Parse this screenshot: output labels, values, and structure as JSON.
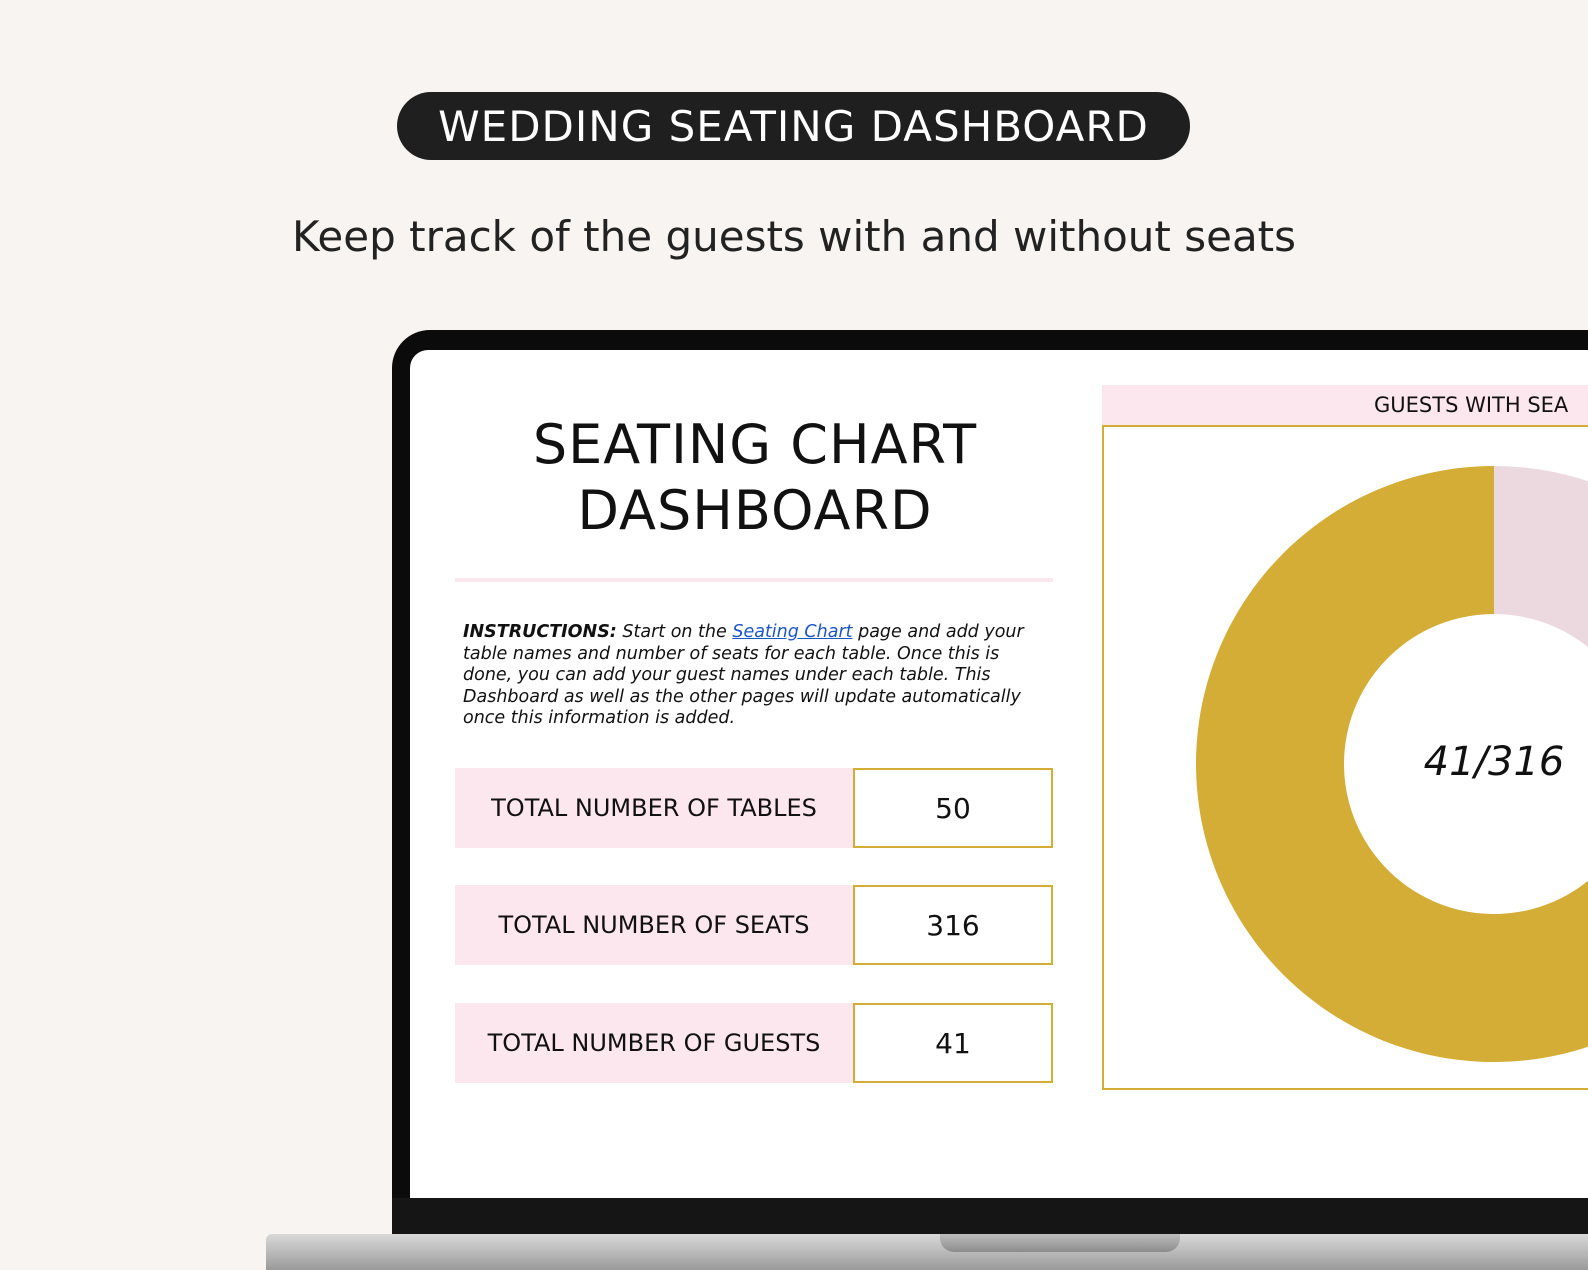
{
  "banner": {
    "title": "WEDDING SEATING DASHBOARD",
    "subtitle": "Keep track of the guests with and without seats"
  },
  "dashboard": {
    "title_line1": "SEATING CHART",
    "title_line2": "DASHBOARD",
    "instructions": {
      "label": "INSTRUCTIONS:",
      "text_before_link": " Start on the ",
      "link_text": "Seating Chart",
      "text_after_link": " page and add your table names and number of seats for each table. Once this is done, you can add your guest names under each table. This Dashboard as well as the other pages will update automatically once this information is added."
    },
    "stats": [
      {
        "label": "TOTAL NUMBER OF TABLES",
        "value": "50"
      },
      {
        "label": "TOTAL NUMBER OF SEATS",
        "value": "316"
      },
      {
        "label": "TOTAL NUMBER OF GUESTS",
        "value": "41"
      }
    ]
  },
  "chart_data": {
    "type": "pie",
    "title": "GUESTS WITH SEA",
    "center_label": "41/316",
    "slices": [
      {
        "value": 41,
        "color": "#ecd9df"
      },
      {
        "value": 275,
        "color": "#d4ad37"
      }
    ]
  },
  "colors": {
    "accent_gold": "#d4ad37",
    "accent_pink": "#fde7ee",
    "pill_dark": "#1f1f1f",
    "background": "#f7f4f1",
    "link_blue": "#1a56c7"
  }
}
